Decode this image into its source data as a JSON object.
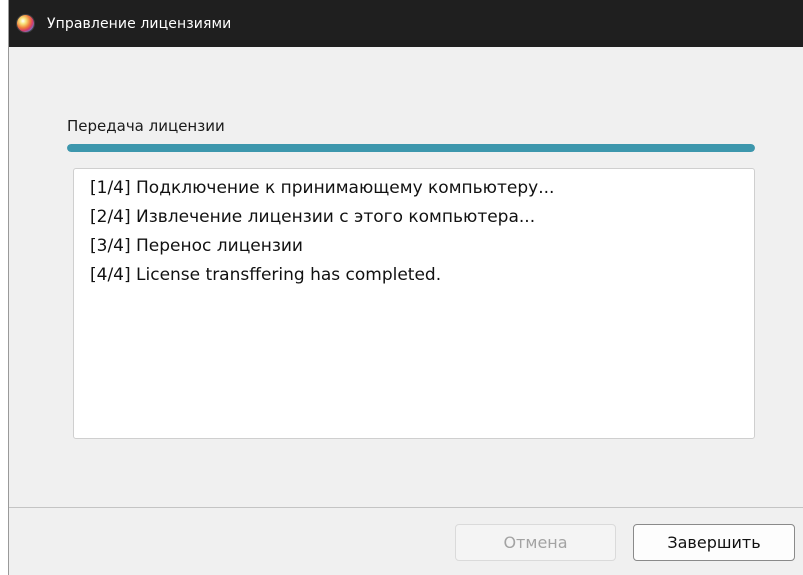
{
  "window": {
    "title": "Управление лицензиями",
    "icon": "color-wheel-icon"
  },
  "transfer": {
    "section_label": "Передача лицензии",
    "progress_percent": 100,
    "accent_color": "#3d97ad",
    "log_lines": [
      "[1/4]  Подключение к принимающему компьютеру...",
      "[2/4] Извлечение лицензии с этого компьютера...",
      "[3/4] Перенос лицензии",
      "[4/4] License transffering has completed."
    ]
  },
  "footer": {
    "cancel_label": "Отмена",
    "cancel_enabled": false,
    "finish_label": "Завершить"
  }
}
